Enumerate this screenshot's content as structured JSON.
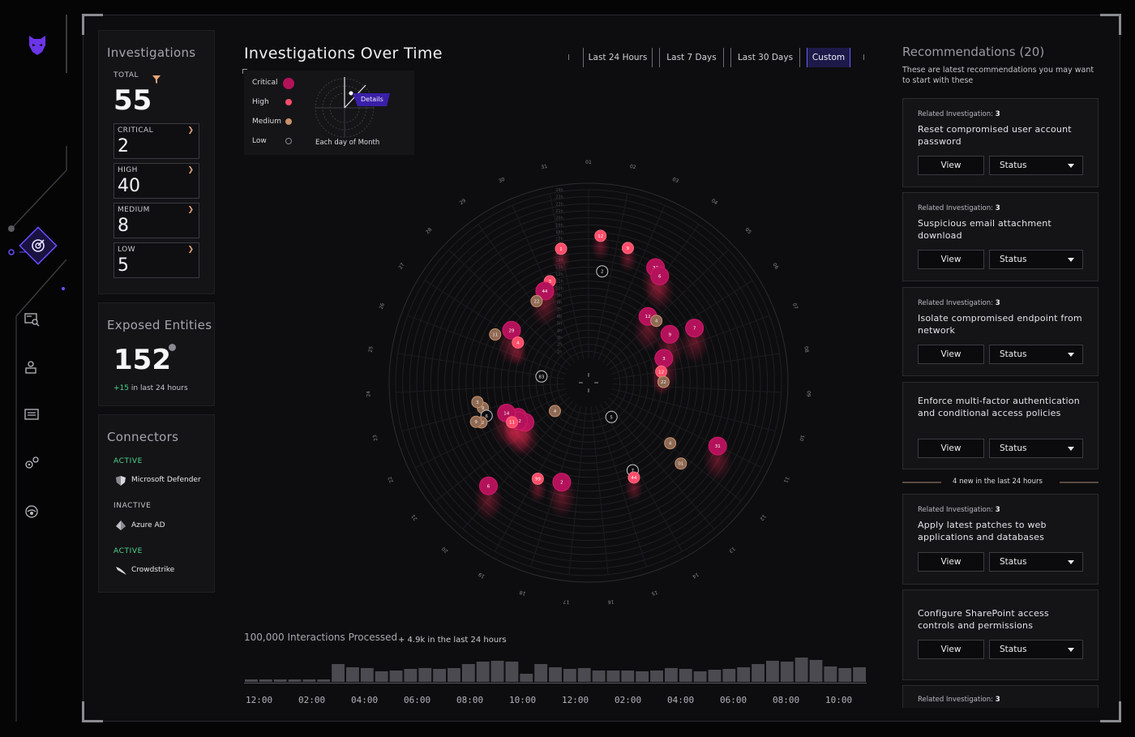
{
  "nav": {
    "items": [
      {
        "icon": "investigations-icon",
        "active": true
      },
      {
        "icon": "search-list-icon",
        "active": false
      },
      {
        "icon": "user-icon",
        "active": false
      },
      {
        "icon": "list-icon",
        "active": false
      },
      {
        "icon": "settings-icon",
        "active": false
      },
      {
        "icon": "support-icon",
        "active": false
      }
    ]
  },
  "investigations": {
    "title": "Investigations",
    "total_label": "TOTAL",
    "total": "55",
    "severity": [
      {
        "label": "CRITICAL",
        "value": "2"
      },
      {
        "label": "HIGH",
        "value": "40"
      },
      {
        "label": "MEDIUM",
        "value": "8"
      },
      {
        "label": "LOW",
        "value": "5"
      }
    ]
  },
  "exposed": {
    "title": "Exposed Entities",
    "value": "152",
    "delta_plus": "+15",
    "delta_text": "in last 24 hours"
  },
  "connectors": {
    "title": "Connectors",
    "items": [
      {
        "status": "ACTIVE",
        "name": "Microsoft Defender",
        "icon": "shield-icon"
      },
      {
        "status": "INACTIVE",
        "name": "Azure AD",
        "icon": "azure-icon"
      },
      {
        "status": "ACTIVE",
        "name": "Crowdstrike",
        "icon": "falcon-icon"
      }
    ]
  },
  "chart": {
    "title": "Investigations Over Time",
    "ranges": [
      "Last 24 Hours",
      "Last 7 Days",
      "Last 30 Days",
      "Custom"
    ],
    "active_range": "Custom",
    "legend": [
      {
        "label": "Critical",
        "color": "#b3125a"
      },
      {
        "label": "High",
        "color": "#ff4d6a"
      },
      {
        "label": "Medium",
        "color": "#c8906a"
      },
      {
        "label": "Low",
        "color": "#0b0b0d"
      }
    ],
    "legend_caption": "Each day of Month",
    "details_label": "Details"
  },
  "chart_data": {
    "type": "scatter",
    "title": "Investigations Over Time",
    "angle_ticks": [
      "01",
      "02",
      "03",
      "04",
      "05",
      "06",
      "07",
      "08",
      "09",
      "10",
      "11",
      "12",
      "13",
      "14",
      "15",
      "16",
      "17",
      "18",
      "19",
      "20",
      "21",
      "22",
      "23",
      "24",
      "25",
      "26",
      "27",
      "28",
      "29",
      "30",
      "31"
    ],
    "radius_ticks": [
      "1h",
      "2h",
      "3h",
      "4h",
      "5h",
      "6h",
      "7h",
      "8h",
      "9h",
      "10h",
      "11h",
      "12h",
      "13h",
      "14h",
      "15h",
      "16h",
      "17h",
      "18h",
      "19h",
      "20h",
      "21h",
      "22h",
      "23h",
      "24h"
    ],
    "points": [
      {
        "day": 1.4,
        "hour": 17.5,
        "value": "12",
        "severity": "High"
      },
      {
        "day": 2.4,
        "hour": 16.5,
        "value": "9",
        "severity": "High"
      },
      {
        "day": 31.0,
        "hour": 16.0,
        "value": "1",
        "severity": "High"
      },
      {
        "day": 3.6,
        "hour": 15.5,
        "value": "33",
        "severity": "Critical"
      },
      {
        "day": 3.9,
        "hour": 14.8,
        "value": "6",
        "severity": "Critical"
      },
      {
        "day": 1.6,
        "hour": 12.5,
        "value": "2",
        "severity": "Low"
      },
      {
        "day": 30.2,
        "hour": 12.0,
        "value": "3",
        "severity": "High"
      },
      {
        "day": 29.8,
        "hour": 11.0,
        "value": "44",
        "severity": "Critical"
      },
      {
        "day": 29.2,
        "hour": 10.3,
        "value": "22",
        "severity": "Medium"
      },
      {
        "day": 4.6,
        "hour": 9.2,
        "value": "12",
        "severity": "Critical"
      },
      {
        "day": 5.1,
        "hour": 9.6,
        "value": "4",
        "severity": "Medium"
      },
      {
        "day": 6.4,
        "hour": 13.5,
        "value": "7",
        "severity": "Critical"
      },
      {
        "day": 6.1,
        "hour": 10.0,
        "value": "9",
        "severity": "Critical"
      },
      {
        "day": 7.2,
        "hour": 7.8,
        "value": "3",
        "severity": "Critical"
      },
      {
        "day": 8.0,
        "hour": 7.0,
        "value": "12",
        "severity": "High"
      },
      {
        "day": 8.7,
        "hour": 7.2,
        "value": "22",
        "severity": "Medium"
      },
      {
        "day": 26.6,
        "hour": 11.5,
        "value": "11",
        "severity": "Medium"
      },
      {
        "day": 27.2,
        "hour": 9.8,
        "value": "29",
        "severity": "Critical"
      },
      {
        "day": 26.8,
        "hour": 8.1,
        "value": "4",
        "severity": "High"
      },
      {
        "day": 24.9,
        "hour": 3.3,
        "value": "83",
        "severity": "Low"
      },
      {
        "day": 20.8,
        "hour": 2.8,
        "value": "4",
        "severity": "Medium"
      },
      {
        "day": 22.0,
        "hour": 7.7,
        "value": "60",
        "severity": "Critical"
      },
      {
        "day": 21.5,
        "hour": 7.2,
        "value": "5",
        "severity": "Critical"
      },
      {
        "day": 21.8,
        "hour": 7.9,
        "value": "12",
        "severity": "Critical"
      },
      {
        "day": 22.5,
        "hour": 9.0,
        "value": "14",
        "severity": "Critical"
      },
      {
        "day": 21.9,
        "hour": 8.8,
        "value": "11",
        "severity": "High"
      },
      {
        "day": 13.6,
        "hour": 2.4,
        "value": "5",
        "severity": "Low"
      },
      {
        "day": 23.1,
        "hour": 12.0,
        "value": "9",
        "severity": "Medium"
      },
      {
        "day": 22.7,
        "hour": 11.8,
        "value": "6",
        "severity": "Low"
      },
      {
        "day": 23.4,
        "hour": 12.6,
        "value": "3",
        "severity": "Medium"
      },
      {
        "day": 22.5,
        "hour": 12.8,
        "value": "12",
        "severity": "Medium"
      },
      {
        "day": 22.6,
        "hour": 13.5,
        "value": "9",
        "severity": "Medium"
      },
      {
        "day": 11.0,
        "hour": 17.0,
        "value": "31",
        "severity": "Critical"
      },
      {
        "day": 11.9,
        "hour": 11.0,
        "value": "4",
        "severity": "Medium"
      },
      {
        "day": 12.3,
        "hour": 14.0,
        "value": "01",
        "severity": "Medium"
      },
      {
        "day": 14.2,
        "hour": 10.5,
        "value": "7",
        "severity": "Low"
      },
      {
        "day": 14.3,
        "hour": 11.5,
        "value": "44",
        "severity": "High"
      },
      {
        "day": 20.3,
        "hour": 17.0,
        "value": "6",
        "severity": "Critical"
      },
      {
        "day": 18.9,
        "hour": 12.0,
        "value": "99",
        "severity": "High"
      },
      {
        "day": 17.8,
        "hour": 11.2,
        "value": "2",
        "severity": "Critical"
      }
    ]
  },
  "interactions": {
    "label": "100,000 Interactions Processed",
    "delta": "+ 4.9k in the last 24 hours",
    "time_labels": [
      "12:00",
      "02:00",
      "04:00",
      "06:00",
      "08:00",
      "10:00",
      "12:00",
      "02:00",
      "04:00",
      "06:00",
      "08:00",
      "10:00"
    ]
  },
  "interactions_data": {
    "type": "bar",
    "values": [
      3,
      3,
      3,
      3,
      3,
      3,
      22,
      18,
      17,
      13,
      14,
      16,
      17,
      16,
      17,
      22,
      25,
      26,
      25,
      10,
      22,
      18,
      16,
      17,
      14,
      14,
      14,
      13,
      14,
      17,
      16,
      13,
      15,
      16,
      18,
      22,
      26,
      25,
      30,
      27,
      19,
      17,
      18
    ]
  },
  "recommendations": {
    "title": "Recommendations (20)",
    "subtitle": "These are latest recommendations you may want to start with these",
    "new_label": "4 new in the last 24 hours",
    "view_label": "View",
    "status_label": "Status",
    "items": [
      {
        "related_label": "Related Investigation:",
        "related": "3",
        "text": "Reset compromised user account password"
      },
      {
        "related_label": "Related Investigation:",
        "related": "3",
        "text": "Suspicious email attachment download"
      },
      {
        "related_label": "Related Investigation:",
        "related": "3",
        "text": "Isolate compromised endpoint from network"
      },
      {
        "related_label": "",
        "related": "",
        "text": "Enforce multi-factor authentication and conditional access policies"
      },
      {
        "related_label": "Related Investigation:",
        "related": "3",
        "text": "Apply latest patches to web applications and databases"
      },
      {
        "related_label": "",
        "related": "",
        "text": "Configure SharePoint access controls and permissions"
      },
      {
        "related_label": "Related Investigation:",
        "related": "3",
        "text": ""
      }
    ]
  }
}
